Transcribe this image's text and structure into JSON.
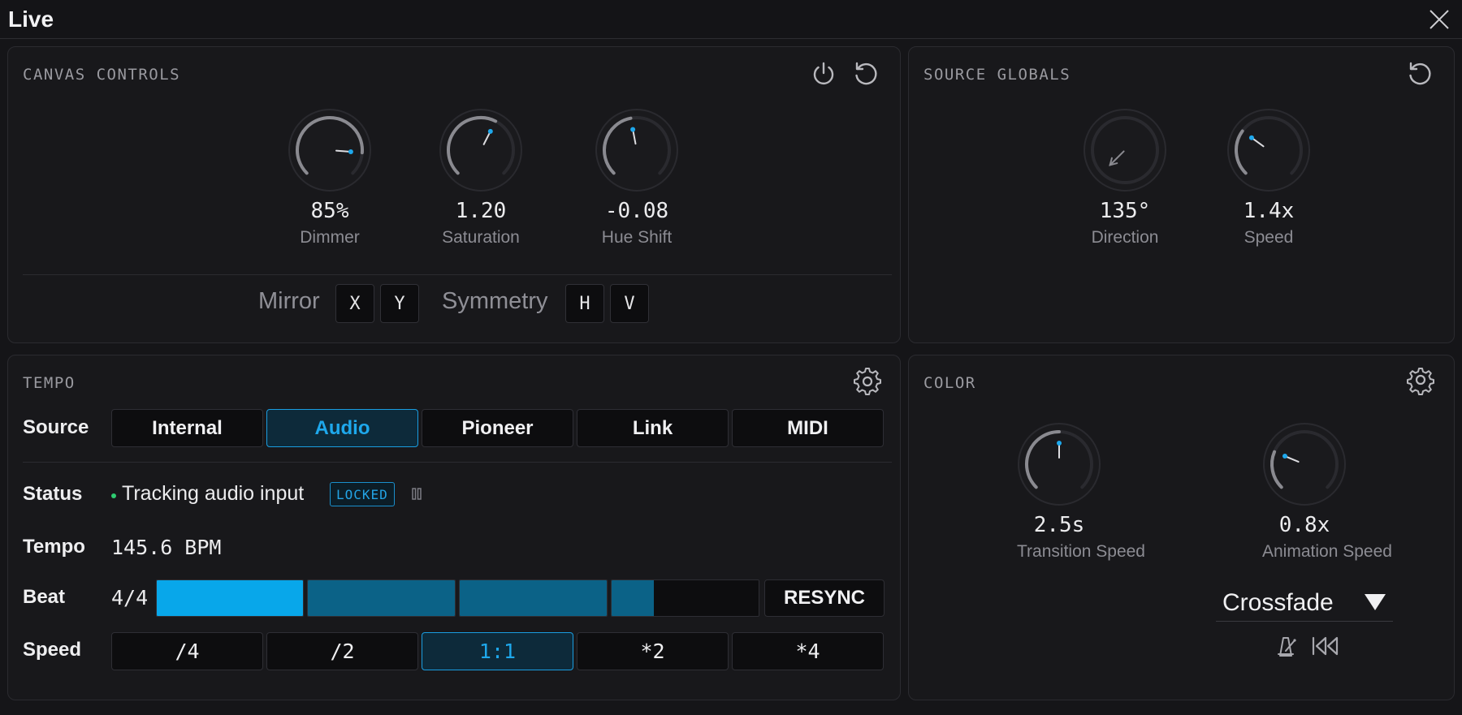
{
  "window": {
    "title": "Live"
  },
  "canvas_controls": {
    "title": "CANVAS CONTROLS",
    "knobs": [
      {
        "value": "85%",
        "label": "Dimmer",
        "level": 0.85
      },
      {
        "value": "1.20",
        "label": "Saturation",
        "level": 0.6
      },
      {
        "value": "-0.08",
        "label": "Hue Shift",
        "level": 0.46
      }
    ],
    "mirror_label": "Mirror",
    "mirror_x": "X",
    "mirror_y": "Y",
    "symmetry_label": "Symmetry",
    "symmetry_h": "H",
    "symmetry_v": "V"
  },
  "source_globals": {
    "title": "SOURCE GLOBALS",
    "knobs": [
      {
        "value": "135°",
        "label": "Direction",
        "angle_deg": 135
      },
      {
        "value": "1.4x",
        "label": "Speed",
        "level": 0.3
      }
    ]
  },
  "tempo": {
    "title": "TEMPO",
    "source_label": "Source",
    "sources": [
      "Internal",
      "Audio",
      "Pioneer",
      "Link",
      "MIDI"
    ],
    "active_source": "Audio",
    "status_label": "Status",
    "status_text": "Tracking audio input",
    "status_badge": "LOCKED",
    "tempo_label": "Tempo",
    "tempo_value": "145.6 BPM",
    "beat_label": "Beat",
    "beat_value": "4/4",
    "beat_progress": [
      1.0,
      1.0,
      1.0,
      0.29
    ],
    "resync_label": "RESYNC",
    "speed_label": "Speed",
    "speeds": [
      "/4",
      "/2",
      "1:1",
      "*2",
      "*4"
    ],
    "active_speed": "1:1"
  },
  "color": {
    "title": "COLOR",
    "knobs": [
      {
        "value": "2.5s",
        "label": "Transition Speed",
        "level": 0.5
      },
      {
        "value": "0.8x",
        "label": "Animation Speed",
        "level": 0.25
      }
    ],
    "mode_value": "Crossfade"
  },
  "colors": {
    "accent": "#1ea8ec",
    "beat_active": "#08a7ea",
    "beat_past": "#0b6287",
    "status_ok": "#2ecc71"
  }
}
